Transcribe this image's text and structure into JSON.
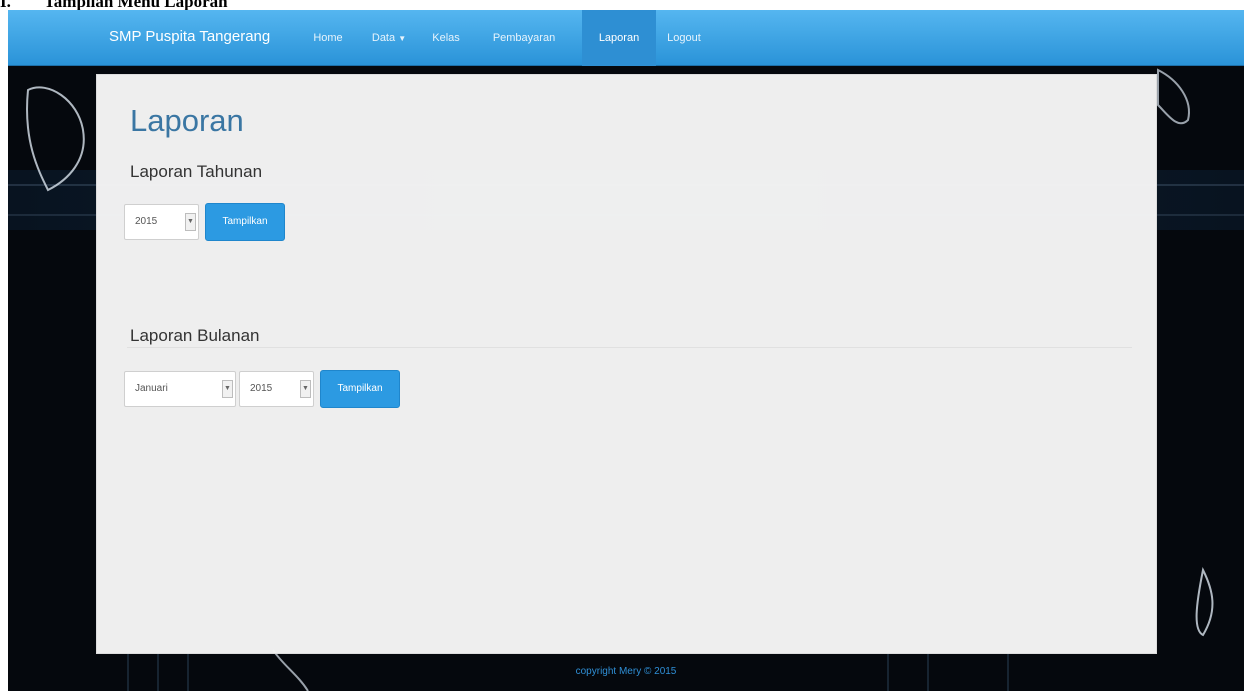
{
  "document": {
    "heading_number": "I.",
    "heading_text": "Tampilan Menu Laporan"
  },
  "navbar": {
    "brand": "SMP Puspita Tangerang",
    "items": [
      {
        "label": "Home"
      },
      {
        "label": "Data"
      },
      {
        "label": "Kelas"
      },
      {
        "label": "Pembayaran"
      },
      {
        "label": "Laporan",
        "active": true
      },
      {
        "label": "Logout"
      }
    ],
    "color": "#2a93d8"
  },
  "main": {
    "title": "Laporan",
    "tahunan": {
      "title": "Laporan Tahunan",
      "year_value": "2015",
      "button": "Tampilkan"
    },
    "bulanan": {
      "title": "Laporan Bulanan",
      "month_value": "Januari",
      "year_value": "2015",
      "button": "Tampilkan"
    }
  },
  "footer": {
    "text": "copyright Mery © 2015"
  },
  "colors": {
    "accent": "#2c9ae2",
    "title": "#3a76a3",
    "background": "#05080d"
  },
  "icons": [
    "dropdown-arrow-icon",
    "caret-down-icon"
  ]
}
